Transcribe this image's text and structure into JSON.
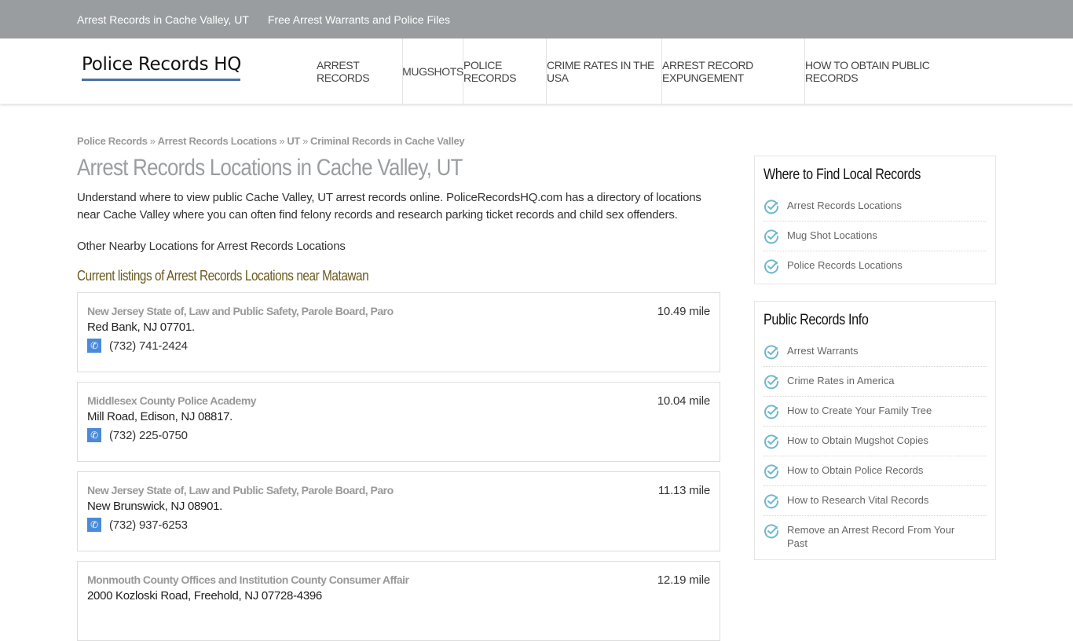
{
  "topbar": {
    "links": [
      "Arrest Records in Cache Valley, UT",
      "Free Arrest Warrants and Police Files"
    ]
  },
  "header": {
    "logo": "Police Records HQ",
    "nav": [
      "ARREST RECORDS",
      "MUGSHOTS",
      "POLICE RECORDS",
      "CRIME RATES IN THE USA",
      "ARREST RECORD EXPUNGEMENT",
      "HOW TO OBTAIN PUBLIC RECORDS"
    ]
  },
  "breadcrumb": [
    "Police Records",
    "Arrest Records Locations",
    "UT",
    "Criminal Records in Cache Valley"
  ],
  "breadcrumb_sep": "»",
  "main": {
    "title": "Arrest Records Locations in Cache Valley, UT",
    "intro": "Understand where to view public Cache Valley, UT arrest records online. PoliceRecordsHQ.com has a directory of locations near Cache Valley where you can often find felony records and research parking ticket records and child sex offenders.",
    "nearby": "Other Nearby Locations for Arrest Records Locations",
    "listings_heading": "Current listings of Arrest Records Locations near Matawan",
    "listings": [
      {
        "name": "New Jersey State of, Law and Public Safety, Parole Board, Paro",
        "address": "Red Bank, NJ 07701.",
        "phone": "(732) 741-2424",
        "distance": "10.49 mile"
      },
      {
        "name": "Middlesex County Police Academy",
        "address": "Mill Road, Edison, NJ 08817.",
        "phone": "(732) 225-0750",
        "distance": "10.04 mile"
      },
      {
        "name": "New Jersey State of, Law and Public Safety, Parole Board, Paro",
        "address": "New Brunswick, NJ 08901.",
        "phone": "(732) 937-6253",
        "distance": "11.13 mile"
      },
      {
        "name": "Monmouth County Offices and Institution County Consumer Affair",
        "address": "2000 Kozloski Road, Freehold, NJ 07728-4396",
        "phone": "",
        "distance": "12.19 mile"
      }
    ]
  },
  "sidebar": {
    "widgets": [
      {
        "title": "Where to Find Local Records",
        "items": [
          "Arrest Records Locations",
          "Mug Shot Locations",
          "Police Records Locations"
        ]
      },
      {
        "title": "Public Records Info",
        "items": [
          "Arrest Warrants",
          "Crime Rates in America",
          "How to Create Your Family Tree",
          "How to Obtain Mugshot Copies",
          "How to Obtain Police Records",
          "How to Research Vital Records",
          "Remove an Arrest Record From Your Past"
        ]
      }
    ]
  },
  "icons": {
    "phone": "phone-icon",
    "check": "check-circle-icon"
  },
  "colors": {
    "topbar": "#9a9da0",
    "logo_underline": "#4a6fa5",
    "phone_icon_bg": "#4a8ad8",
    "check_icon": "#6fb8d0",
    "listings_heading": "#6b5a1e"
  }
}
